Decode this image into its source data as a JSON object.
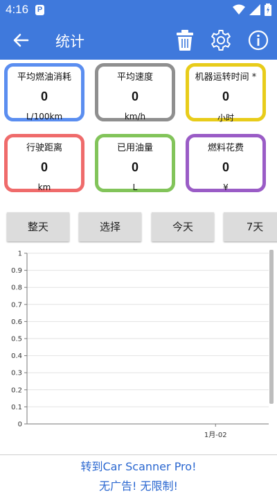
{
  "status_bar": {
    "time": "4:16",
    "notification_badge": "P"
  },
  "app_bar": {
    "title": "统计"
  },
  "cards": [
    {
      "label": "平均燃油消耗",
      "value": "0",
      "unit": "L/100km",
      "color": "#5b8ef0"
    },
    {
      "label": "平均速度",
      "value": "0",
      "unit": "km/h",
      "color": "#8f8f8f"
    },
    {
      "label": "机器运转时间 *",
      "value": "0",
      "unit": "小时",
      "color": "#e8cc1a"
    },
    {
      "label": "行驶距离",
      "value": "0",
      "unit": "km",
      "color": "#ef6b6b"
    },
    {
      "label": "已用油量",
      "value": "0",
      "unit": "L",
      "color": "#82c45a"
    },
    {
      "label": "燃料花费",
      "value": "0",
      "unit": "¥",
      "color": "#9a5cc6"
    }
  ],
  "period_buttons": [
    "整天",
    "选择",
    "今天",
    "7天"
  ],
  "chart_data": {
    "type": "line",
    "title": "",
    "xlabel": "",
    "ylabel": "",
    "ylim": [
      0,
      1
    ],
    "y_ticks": [
      "0",
      "0.1",
      "0.2",
      "0.3",
      "0.4",
      "0.5",
      "0.6",
      "0.7",
      "0.8",
      "0.9",
      "1"
    ],
    "x_ticks": [
      "1月-02"
    ],
    "series": [],
    "grid": true
  },
  "promo": {
    "line1": "转到Car Scanner Pro!",
    "line2": "无广告! 无限制!"
  }
}
